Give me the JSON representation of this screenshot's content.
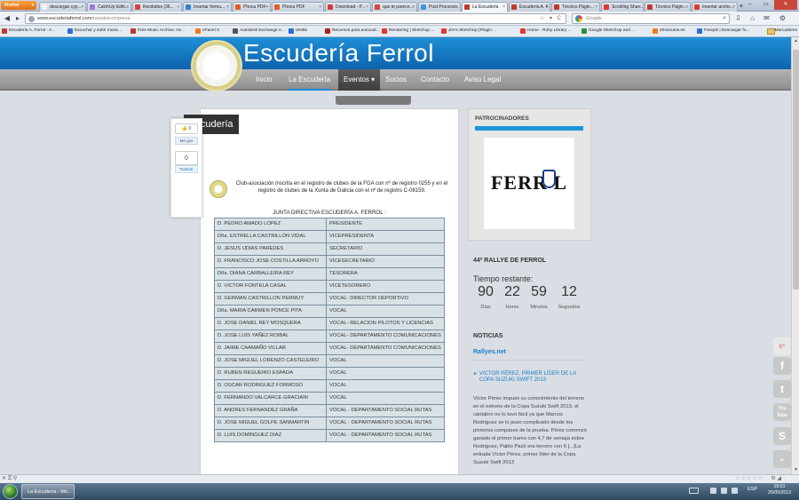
{
  "browser": {
    "menu_button": "Firefox",
    "tabs": [
      {
        "label": "descargar cyp...",
        "color": "#f2f2f2"
      },
      {
        "label": "CatchUp Editi...",
        "color": "#9c7bd6"
      },
      {
        "label": "Recibidos (36...",
        "color": "#d6463a"
      },
      {
        "label": "Insertar formu...",
        "color": "#3a7fd6"
      },
      {
        "label": "Phoca PDF - J...",
        "color": "#e45d20"
      },
      {
        "label": "Phoca PDF",
        "color": "#e45d20"
      },
      {
        "label": "Download - P...",
        "color": "#d63a3a"
      },
      {
        "label": "que te parece...",
        "color": "#d6463a"
      },
      {
        "label": "Post Processi...",
        "color": "#3a9bd6"
      },
      {
        "label": "La Escudería",
        "color": "#c0392b",
        "active": true
      },
      {
        "label": "Escudería A. F...",
        "color": "#c0392b"
      },
      {
        "label": "Técnico Págin...",
        "color": "#c0392b"
      },
      {
        "label": "Scrolling Shar...",
        "color": "#e03a2e"
      },
      {
        "label": "Técnico Págin...",
        "color": "#c0392b"
      },
      {
        "label": "Insertar archiv...",
        "color": "#e03a2e"
      }
    ],
    "new_tab": "+",
    "window_controls": [
      "–",
      "▭",
      "✕"
    ],
    "url_host": "www.escuderiaferrol.com",
    "url_path": "/nuestra-empresa",
    "url_controls": "☆ ▾ C",
    "search_placeholder": "Google",
    "search_icon": "⌕",
    "nav_icons": [
      "⇩",
      "⌂",
      "✉",
      "⚙"
    ],
    "bookmarks": [
      {
        "label": "Escudería A. Ferrol - A...",
        "color": "#c0392b"
      },
      {
        "label": "Escuchar y subir music...",
        "color": "#2a6fd6"
      },
      {
        "label": "Free Music Archive: Ae...",
        "color": "#c0392b"
      },
      {
        "label": "cPanel X",
        "color": "#f07b1e"
      },
      {
        "label": "Autodesk Exchange A...",
        "color": "#555555"
      },
      {
        "label": "iZettle",
        "color": "#2a6fd6"
      },
      {
        "label": "Recursos para autocad...",
        "color": "#aa2222"
      },
      {
        "label": "Rendering | Sketchup ...",
        "color": "#e03a2e"
      },
      {
        "label": "Jim's SketchUp [Plugin...",
        "color": "#e03a2e"
      },
      {
        "label": "Home - Ruby Library ...",
        "color": "#e03a2e"
      },
      {
        "label": "Google SketchUp and ...",
        "color": "#2a8f3e"
      },
      {
        "label": "20minutos.es",
        "color": "#f07b1e"
      },
      {
        "label": "Freepik | Descargar fo...",
        "color": "#2a6fd6"
      }
    ],
    "bookmarks_folder": "Marcadores"
  },
  "site": {
    "title": "Escudería Ferrol",
    "menu": [
      "Inicio",
      "La Escudería",
      "Eventos",
      "Socios",
      "Contacto",
      "Aviso Legal"
    ],
    "events_arrow": "▾",
    "page_title": "Escudería",
    "intro": "Club-asociación inscrita en el registro de clubes de la FGA con nº de registro 0255 y en el registro de clubes de la Xunta de Galicia con el nº de registro C-08159.",
    "table_caption": "JUNTA DIRECTIVA ESCUDERÍA A. FERROL :",
    "junta": [
      [
        "D. PEDRO AMADO LOPEZ",
        "PRESIDENTE"
      ],
      [
        "Dña. ESTRELLA CASTRILLÓN VIDAL",
        "VICEPRESIDENTA"
      ],
      [
        "D. JESUS UDIAS PAREDES",
        "SECRETARIO"
      ],
      [
        "D. FRANCISCO JOSE COSTILLA ARROYO",
        "VICESECRETARIO"
      ],
      [
        "Dña. DIANA CARBALLEIRA REY",
        "TESORERA"
      ],
      [
        "D. VICTOR FONTELA CASAL",
        "VICETESORERO"
      ],
      [
        "D. GERMAN CASTRILLON PERMUY",
        "VOCAL- DIRECTOR DEPORTIVO"
      ],
      [
        "Dña. MARIA CARMEN PONCE PITA",
        "VOCAL"
      ],
      [
        "D. JOSE DANIEL REY MOSQUERA",
        "VOCAL- RELACION PILOTOS Y LICENCIAS"
      ],
      [
        "D. JOSE LUIS YAÑEZ ROIBAL",
        "VOCAL- DEPARTAMENTO COMUNICACIONES"
      ],
      [
        "D. JAIME CAAMAÑO VILLAR",
        "VOCAL- DEPARTAMENTO COMUNICACIONES"
      ],
      [
        "D. JOSE MIGUEL LORENZO CASTELEIRO",
        "VOCAL"
      ],
      [
        "D. RUBEN REGUEIRO ESPADA",
        "VOCAL"
      ],
      [
        "D. OSCAR RODRIGUEZ FORMOSO",
        "VOCAL"
      ],
      [
        "D. FERNANDO VALCARCE GRACIANI",
        "VOCAL"
      ],
      [
        "D. ANDRES FERNANDEZ GRAÑA",
        "VOCAL - DEPARTAMENTO SOCIAL RUTAS"
      ],
      [
        "D. JOSE MIGUEL GOLPE SANMARTIN",
        "VOCAL - DEPARTAMENTO SOCIAL RUTAS"
      ],
      [
        "D. LUIS DOMINGUEZ DIAZ",
        "VOCAL - DEPARTAMENTO SOCIAL RUTAS"
      ]
    ],
    "share": {
      "like": "👍 0",
      "fb": "Me gus",
      "count": "0",
      "tweet": "Twittear"
    },
    "sidebar": {
      "sponsors_title": "PATROCINADORES",
      "sponsor_name": "FERR L",
      "rally_title": "44º RALLYE DE FERROL",
      "countdown_label": "Tiempo restante:",
      "countdown": [
        {
          "value": "90",
          "unit": "Días"
        },
        {
          "value": "22",
          "unit": "Horas"
        },
        {
          "value": "59",
          "unit": "Minutos"
        },
        {
          "value": "12",
          "unit": "Segundos"
        }
      ],
      "news_title": "NOTICIAS",
      "news_source": "Rallyes.net",
      "news_link": "VICTOR PÉREZ, PRIMER LÍDER DE LA COPA SUZUKI SWIFT 2013",
      "news_body": "Víctor Pérez impuso su conocimiento del terreno en el estreno de la Copa Suzuki Swift 2013, el cántabro no lo tuvo fácil ya que Marcos Rodríguez se lo puso complicado desde los primeros compases de la prueba. Pérez comenzó ganado el primer tramo con 4,7 de ventaja sobre Rodríguez, Pablo Pazó era tercero con 6 [...]La entrada Víctor Pérez, primer líder de la Copa Suzuki Swift 2013"
    },
    "social_icons": [
      {
        "name": "gplus-icon",
        "glyph": "g+"
      },
      {
        "name": "facebook-icon",
        "glyph": "f"
      },
      {
        "name": "twitter-icon",
        "glyph": "t"
      },
      {
        "name": "youtube-icon",
        "glyph": "You Tube"
      },
      {
        "name": "skype-icon",
        "glyph": "S"
      },
      {
        "name": "scroll-down-icon",
        "glyph": "⌄"
      }
    ]
  },
  "addon_bar": {
    "close": "✕ ⚿ ⚲",
    "stars": "☆☆☆☆☆"
  },
  "taskbar": {
    "active_window": "La Escudería - Mo...",
    "language": "ESP",
    "time": "19:01",
    "date": "25/05/2013"
  }
}
